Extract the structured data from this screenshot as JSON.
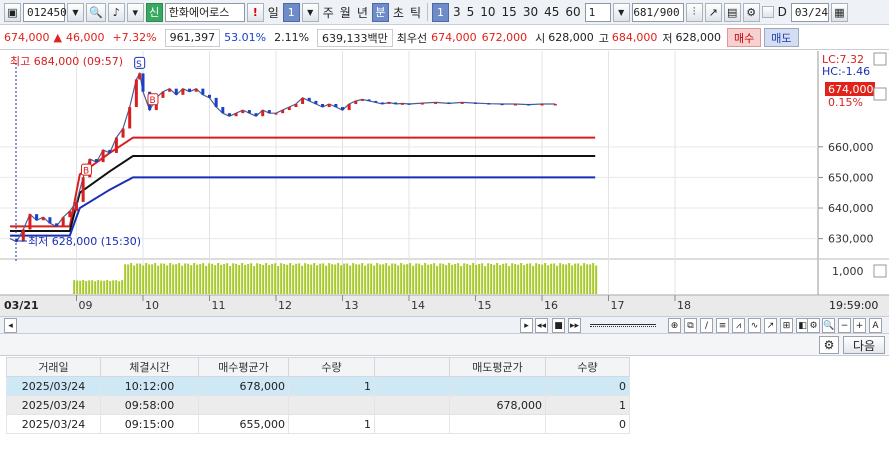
{
  "toolbar": {
    "stock_code": "012450",
    "stock_name": "한화에어로스",
    "badge_credit": "신",
    "warn": "!",
    "period_day": "일",
    "period_num": "1",
    "period_week": "주",
    "period_month": "월",
    "period_year": "년",
    "period_minute": "분",
    "period_second": "초",
    "period_tick": "틱",
    "intervals": [
      "1",
      "3",
      "5",
      "10",
      "15",
      "30",
      "45",
      "60"
    ],
    "interval_value": "1",
    "count": "681/900",
    "checkbox_label": "D",
    "date": "03/24"
  },
  "quote": {
    "price": "674,000",
    "change_arrow": "▲",
    "change": "46,000",
    "change_pct": "+7.32%",
    "volume": "961,397",
    "ratio": "53.01%",
    "turnover": "2.11%",
    "amount": "639,133백만",
    "best_label": "최우선",
    "best_ask": "674,000",
    "best_bid": "672,000",
    "open_label": "시",
    "open": "628,000",
    "high_label": "고",
    "high": "684,000",
    "low_label": "저",
    "low": "628,000",
    "buy_button": "매수",
    "sell_button": "매도"
  },
  "chart_data": {
    "type": "line",
    "title": "",
    "high_annotation": "최고 684,000 (09:57)",
    "low_annotation": "최저 628,000 (15:30)",
    "x_tick_labels": [
      "09",
      "10",
      "11",
      "12",
      "13",
      "14",
      "15",
      "16",
      "17",
      "18"
    ],
    "x_first_label": "03/21",
    "x_last_label": "19:59:00",
    "ylim": [
      624000,
      690000
    ],
    "y_ticks": [
      630000,
      640000,
      650000,
      660000
    ],
    "y_tick_labels": [
      "630,000",
      "640,000",
      "650,000",
      "660,000"
    ],
    "lc_label": "LC:7.32",
    "hc_label": "HC:-1.46",
    "current_price_label": "674,000",
    "current_pct_label": "0.15%",
    "volume_axis_label": "1,000",
    "price_series": [
      {
        "t": 0.0,
        "v": 630000
      },
      {
        "t": 0.1,
        "v": 629000
      },
      {
        "t": 0.2,
        "v": 633000
      },
      {
        "t": 0.3,
        "v": 638000
      },
      {
        "t": 0.4,
        "v": 636000
      },
      {
        "t": 0.5,
        "v": 637000
      },
      {
        "t": 0.6,
        "v": 635000
      },
      {
        "t": 0.7,
        "v": 634000
      },
      {
        "t": 0.8,
        "v": 637000
      },
      {
        "t": 0.9,
        "v": 639000
      },
      {
        "t": 1.0,
        "v": 642000
      },
      {
        "t": 1.1,
        "v": 650000
      },
      {
        "t": 1.2,
        "v": 656000
      },
      {
        "t": 1.3,
        "v": 655000
      },
      {
        "t": 1.4,
        "v": 659000
      },
      {
        "t": 1.5,
        "v": 658000
      },
      {
        "t": 1.6,
        "v": 663000
      },
      {
        "t": 1.7,
        "v": 666000
      },
      {
        "t": 1.8,
        "v": 673000
      },
      {
        "t": 1.9,
        "v": 682000
      },
      {
        "t": 1.95,
        "v": 684000
      },
      {
        "t": 2.0,
        "v": 678000
      },
      {
        "t": 2.1,
        "v": 672000
      },
      {
        "t": 2.2,
        "v": 676000
      },
      {
        "t": 2.3,
        "v": 678000
      },
      {
        "t": 2.4,
        "v": 679000
      },
      {
        "t": 2.5,
        "v": 677000
      },
      {
        "t": 2.6,
        "v": 679000
      },
      {
        "t": 2.7,
        "v": 678000
      },
      {
        "t": 2.8,
        "v": 679000
      },
      {
        "t": 2.9,
        "v": 677000
      },
      {
        "t": 3.0,
        "v": 676000
      },
      {
        "t": 3.1,
        "v": 673000
      },
      {
        "t": 3.2,
        "v": 671000
      },
      {
        "t": 3.3,
        "v": 670000
      },
      {
        "t": 3.4,
        "v": 671000
      },
      {
        "t": 3.5,
        "v": 672000
      },
      {
        "t": 3.6,
        "v": 671000
      },
      {
        "t": 3.7,
        "v": 670000
      },
      {
        "t": 3.8,
        "v": 672000
      },
      {
        "t": 3.9,
        "v": 671000
      },
      {
        "t": 4.0,
        "v": 671000
      },
      {
        "t": 4.1,
        "v": 672000
      },
      {
        "t": 4.2,
        "v": 673000
      },
      {
        "t": 4.3,
        "v": 674000
      },
      {
        "t": 4.4,
        "v": 676000
      },
      {
        "t": 4.5,
        "v": 675000
      },
      {
        "t": 4.6,
        "v": 674000
      },
      {
        "t": 4.7,
        "v": 673000
      },
      {
        "t": 4.8,
        "v": 674000
      },
      {
        "t": 4.9,
        "v": 673000
      },
      {
        "t": 5.0,
        "v": 672000
      },
      {
        "t": 5.1,
        "v": 674000
      },
      {
        "t": 5.2,
        "v": 675000
      },
      {
        "t": 5.3,
        "v": 675500
      },
      {
        "t": 5.4,
        "v": 675000
      },
      {
        "t": 5.5,
        "v": 674500
      },
      {
        "t": 5.6,
        "v": 674000
      },
      {
        "t": 5.7,
        "v": 674500
      },
      {
        "t": 5.8,
        "v": 674000
      },
      {
        "t": 5.9,
        "v": 674200
      },
      {
        "t": 6.0,
        "v": 674000
      },
      {
        "t": 6.2,
        "v": 674300
      },
      {
        "t": 6.4,
        "v": 674500
      },
      {
        "t": 6.6,
        "v": 674200
      },
      {
        "t": 6.8,
        "v": 674500
      },
      {
        "t": 7.0,
        "v": 674300
      },
      {
        "t": 7.2,
        "v": 674100
      },
      {
        "t": 7.4,
        "v": 674000
      },
      {
        "t": 7.6,
        "v": 674000
      },
      {
        "t": 7.8,
        "v": 673800
      },
      {
        "t": 8.0,
        "v": 674000
      },
      {
        "t": 8.2,
        "v": 674000
      }
    ],
    "series": [
      {
        "name": "",
        "color": "#d81f1f",
        "values": [
          {
            "t": 0.0,
            "v": 634000
          },
          {
            "t": 0.9,
            "v": 634000
          },
          {
            "t": 1.05,
            "v": 651000
          },
          {
            "t": 1.5,
            "v": 658000
          },
          {
            "t": 1.85,
            "v": 663000
          },
          {
            "t": 8.8,
            "v": 663000
          }
        ]
      },
      {
        "name": "",
        "color": "#111111",
        "values": [
          {
            "t": 0.0,
            "v": 632500
          },
          {
            "t": 0.9,
            "v": 632500
          },
          {
            "t": 1.05,
            "v": 645000
          },
          {
            "t": 1.5,
            "v": 652000
          },
          {
            "t": 1.85,
            "v": 657000
          },
          {
            "t": 8.8,
            "v": 657000
          }
        ]
      },
      {
        "name": "",
        "color": "#1a2fb5",
        "values": [
          {
            "t": 0.0,
            "v": 631000
          },
          {
            "t": 0.9,
            "v": 631000
          },
          {
            "t": 1.05,
            "v": 640000
          },
          {
            "t": 1.5,
            "v": 646000
          },
          {
            "t": 1.85,
            "v": 650000
          },
          {
            "t": 8.8,
            "v": 650000
          }
        ]
      }
    ],
    "trade_markers": [
      {
        "label": "B",
        "t": 1.15,
        "v": 655000,
        "color": "#d81f1f"
      },
      {
        "label": "S",
        "t": 1.95,
        "v": 684000,
        "color": "#1a2fb5"
      },
      {
        "label": "B",
        "t": 2.15,
        "v": 678000,
        "color": "#d81f1f"
      }
    ],
    "volume_series": {
      "start_t": 0.95,
      "end_t": 8.8,
      "level_before_10": 0.45,
      "level_after_10": 1.0
    }
  },
  "lower": {
    "next_button": "다음",
    "columns": [
      "거래일",
      "체결시간",
      "매수평균가",
      "수량",
      "",
      "매도평균가",
      "수량"
    ],
    "rows": [
      [
        "2025/03/24",
        "10:12:00",
        "678,000",
        "1",
        "",
        "",
        "0"
      ],
      [
        "2025/03/24",
        "09:58:00",
        "",
        "",
        "",
        "678,000",
        "1"
      ],
      [
        "2025/03/24",
        "09:15:00",
        "655,000",
        "1",
        "",
        "",
        "0"
      ]
    ]
  }
}
